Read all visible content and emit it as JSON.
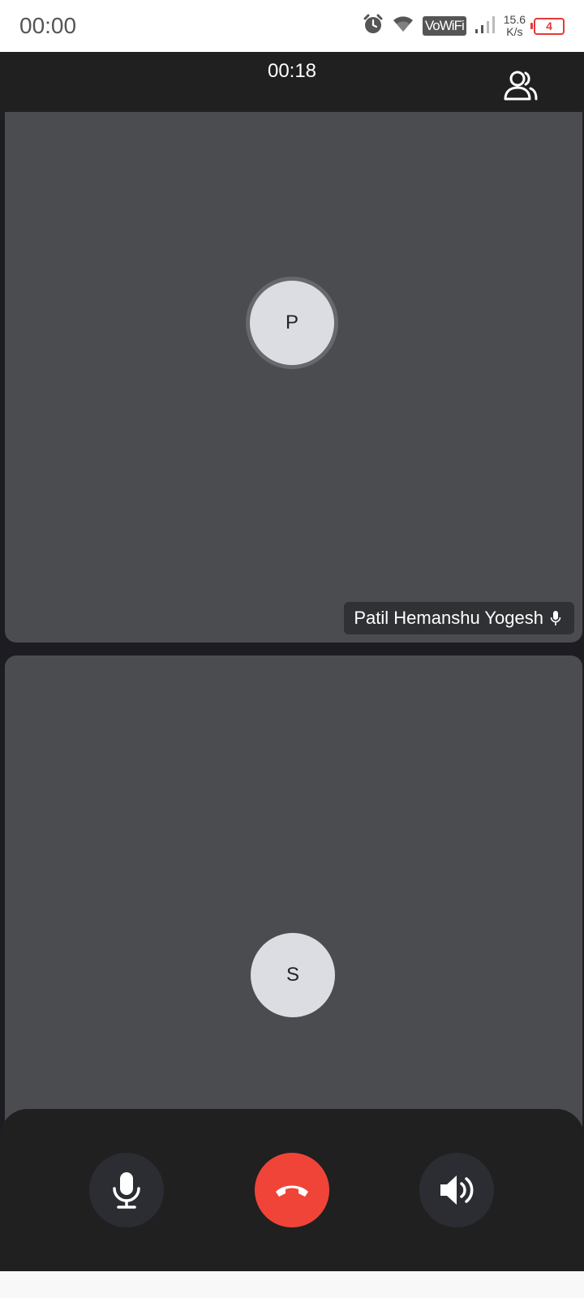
{
  "status_bar": {
    "time": "00:00",
    "vowifi_label": "VoWiFi",
    "net_speed_value": "15.6",
    "net_speed_unit": "K/s",
    "battery_level": "4"
  },
  "call": {
    "timer": "00:18",
    "participants": [
      {
        "initial": "P",
        "name": "Patil Hemanshu Yogesh",
        "speaking": true
      },
      {
        "initial": "S",
        "name": "",
        "speaking": false
      }
    ]
  },
  "controls": {
    "mic_icon": "microphone-icon",
    "end_call_icon": "phone-hangup-icon",
    "speaker_icon": "speaker-volume-icon"
  },
  "colors": {
    "end_call": "#f04438",
    "tile": "#4b4c4f",
    "header": "#202020",
    "battery_low": "#e53935"
  }
}
